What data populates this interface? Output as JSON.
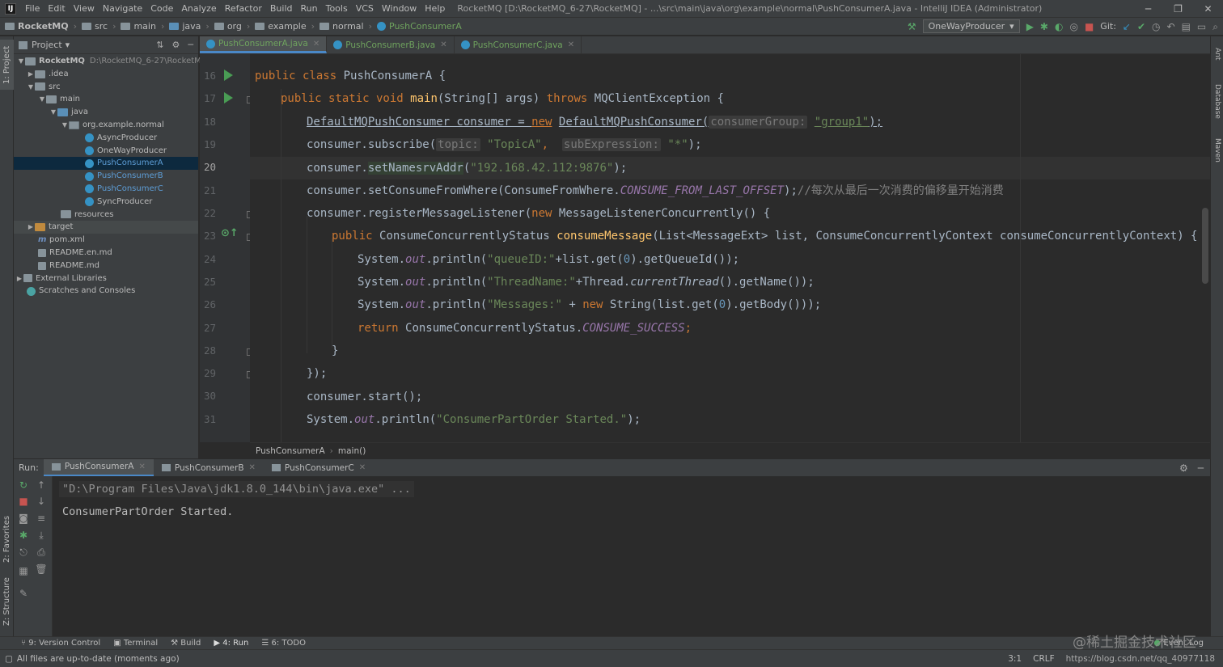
{
  "menu": [
    "File",
    "Edit",
    "View",
    "Navigate",
    "Code",
    "Analyze",
    "Refactor",
    "Build",
    "Run",
    "Tools",
    "VCS",
    "Window",
    "Help"
  ],
  "window_title": "RocketMQ [D:\\RocketMQ_6-27\\RocketMQ] - ...\\src\\main\\java\\org\\example\\normal\\PushConsumerA.java - IntelliJ IDEA (Administrator)",
  "breadcrumb": [
    "RocketMQ",
    "src",
    "main",
    "java",
    "org",
    "example",
    "normal",
    "PushConsumerA"
  ],
  "run_config": "OneWayProducer",
  "git_label": "Git:",
  "left_strip": {
    "project": "1: Project",
    "favorites": "2: Favorites",
    "structure": "Z: Structure"
  },
  "right_strip": {
    "ant": "Ant",
    "database": "Database",
    "maven": "Maven"
  },
  "project_panel": {
    "title": "Project",
    "tree": [
      {
        "label": "RocketMQ",
        "path": "D:\\RocketMQ_6-27\\RocketMQ"
      },
      {
        "label": ".idea"
      },
      {
        "label": "src"
      },
      {
        "label": "main"
      },
      {
        "label": "java"
      },
      {
        "label": "org.example.normal"
      },
      {
        "label": "AsyncProducer"
      },
      {
        "label": "OneWayProducer"
      },
      {
        "label": "PushConsumerA"
      },
      {
        "label": "PushConsumerB"
      },
      {
        "label": "PushConsumerC"
      },
      {
        "label": "SyncProducer"
      },
      {
        "label": "resources"
      },
      {
        "label": "target"
      },
      {
        "label": "pom.xml"
      },
      {
        "label": "README.en.md"
      },
      {
        "label": "README.md"
      },
      {
        "label": "External Libraries"
      },
      {
        "label": "Scratches and Consoles"
      }
    ]
  },
  "editor_tabs": [
    "PushConsumerA.java",
    "PushConsumerB.java",
    "PushConsumerC.java"
  ],
  "line_numbers": [
    "16",
    "17",
    "18",
    "19",
    "20",
    "21",
    "22",
    "23",
    "24",
    "25",
    "26",
    "27",
    "28",
    "29",
    "30",
    "31"
  ],
  "code": {
    "l16": {
      "kw1": "public class",
      "name": "PushConsumerA",
      "rest": "{"
    },
    "l17": {
      "kw1": "public static void",
      "fn": "main",
      "args": "(String[] args)",
      "kw2": "throws",
      "exc": "MQClientException {"
    },
    "l18": {
      "a": "DefaultMQPushConsumer consumer = ",
      "kw": "new",
      "b": "DefaultMQPushConsumer(",
      "hint": "consumerGroup:",
      "str": "\"group1\"",
      "c": ");"
    },
    "l19": {
      "a": "consumer.subscribe(",
      "hint1": "topic:",
      "str1": "\"TopicA\"",
      "comma": ",",
      "hint2": "subExpression:",
      "str2": "\"*\"",
      "c": ");"
    },
    "l20": {
      "a": "consumer.",
      "fn": "setNamesrvAddr",
      "b": "(",
      "str": "\"192.168.42.112:9876\"",
      "c": ");"
    },
    "l21": {
      "a": "consumer.setConsumeFromWhere(ConsumeFromWhere.",
      "st": "CONSUME_FROM_LAST_OFFSET",
      "b": ");",
      "cmt": "//每次从最后一次消费的偏移量开始消费"
    },
    "l22": {
      "a": "consumer.registerMessageListener(",
      "kw": "new",
      "b": "MessageListenerConcurrently() {"
    },
    "l23": {
      "kw": "public",
      "a": "ConsumeConcurrentlyStatus",
      "fn": "consumeMessage",
      "b": "(List<MessageExt> list, ConsumeConcurrentlyContext consumeConcurrentlyContext) {"
    },
    "l24": {
      "a": "System.",
      "out": "out",
      "b": ".println(",
      "str": "\"queueID:\"",
      "c": "+list.get(",
      "num": "0",
      "d": ").getQueueId());"
    },
    "l25": {
      "a": "System.",
      "out": "out",
      "b": ".println(",
      "str": "\"ThreadName:\"",
      "c": "+Thread.",
      "it": "currentThread",
      "d": "().getName());"
    },
    "l26": {
      "a": "System.",
      "out": "out",
      "b": ".println(",
      "str": "\"Messages:\"",
      "c": " + ",
      "kw": "new",
      "d": "String(list.get(",
      "num": "0",
      "e": ").getBody()));"
    },
    "l27": {
      "kw": "return",
      "a": "ConsumeConcurrentlyStatus.",
      "st": "CONSUME_SUCCESS",
      "b": ";"
    },
    "l28": {
      "a": "}"
    },
    "l29": {
      "a": "});"
    },
    "l30": {
      "a": "consumer.start();"
    },
    "l31": {
      "a": "System.",
      "out": "out",
      "b": ".println(",
      "str": "\"ConsumerPartOrder Started.\"",
      "c": ");"
    }
  },
  "editor_breadcrumb": [
    "PushConsumerA",
    "main()"
  ],
  "run_panel": {
    "label": "Run:",
    "tabs": [
      "PushConsumerA",
      "PushConsumerB",
      "PushConsumerC"
    ]
  },
  "console": {
    "cmd": "\"D:\\Program Files\\Java\\jdk1.8.0_144\\bin\\java.exe\" ...",
    "out": "ConsumerPartOrder Started."
  },
  "bottom_tools": [
    "9: Version Control",
    "Terminal",
    "Build",
    "4: Run",
    "6: TODO"
  ],
  "event_log": "Event Log",
  "status": {
    "message": "All files are up-to-date (moments ago)",
    "position": "3:1",
    "encoding": "CRLF",
    "watermark": "@稀土掘金技术社区",
    "url": "https://blog.csdn.net/qq_40977118"
  }
}
